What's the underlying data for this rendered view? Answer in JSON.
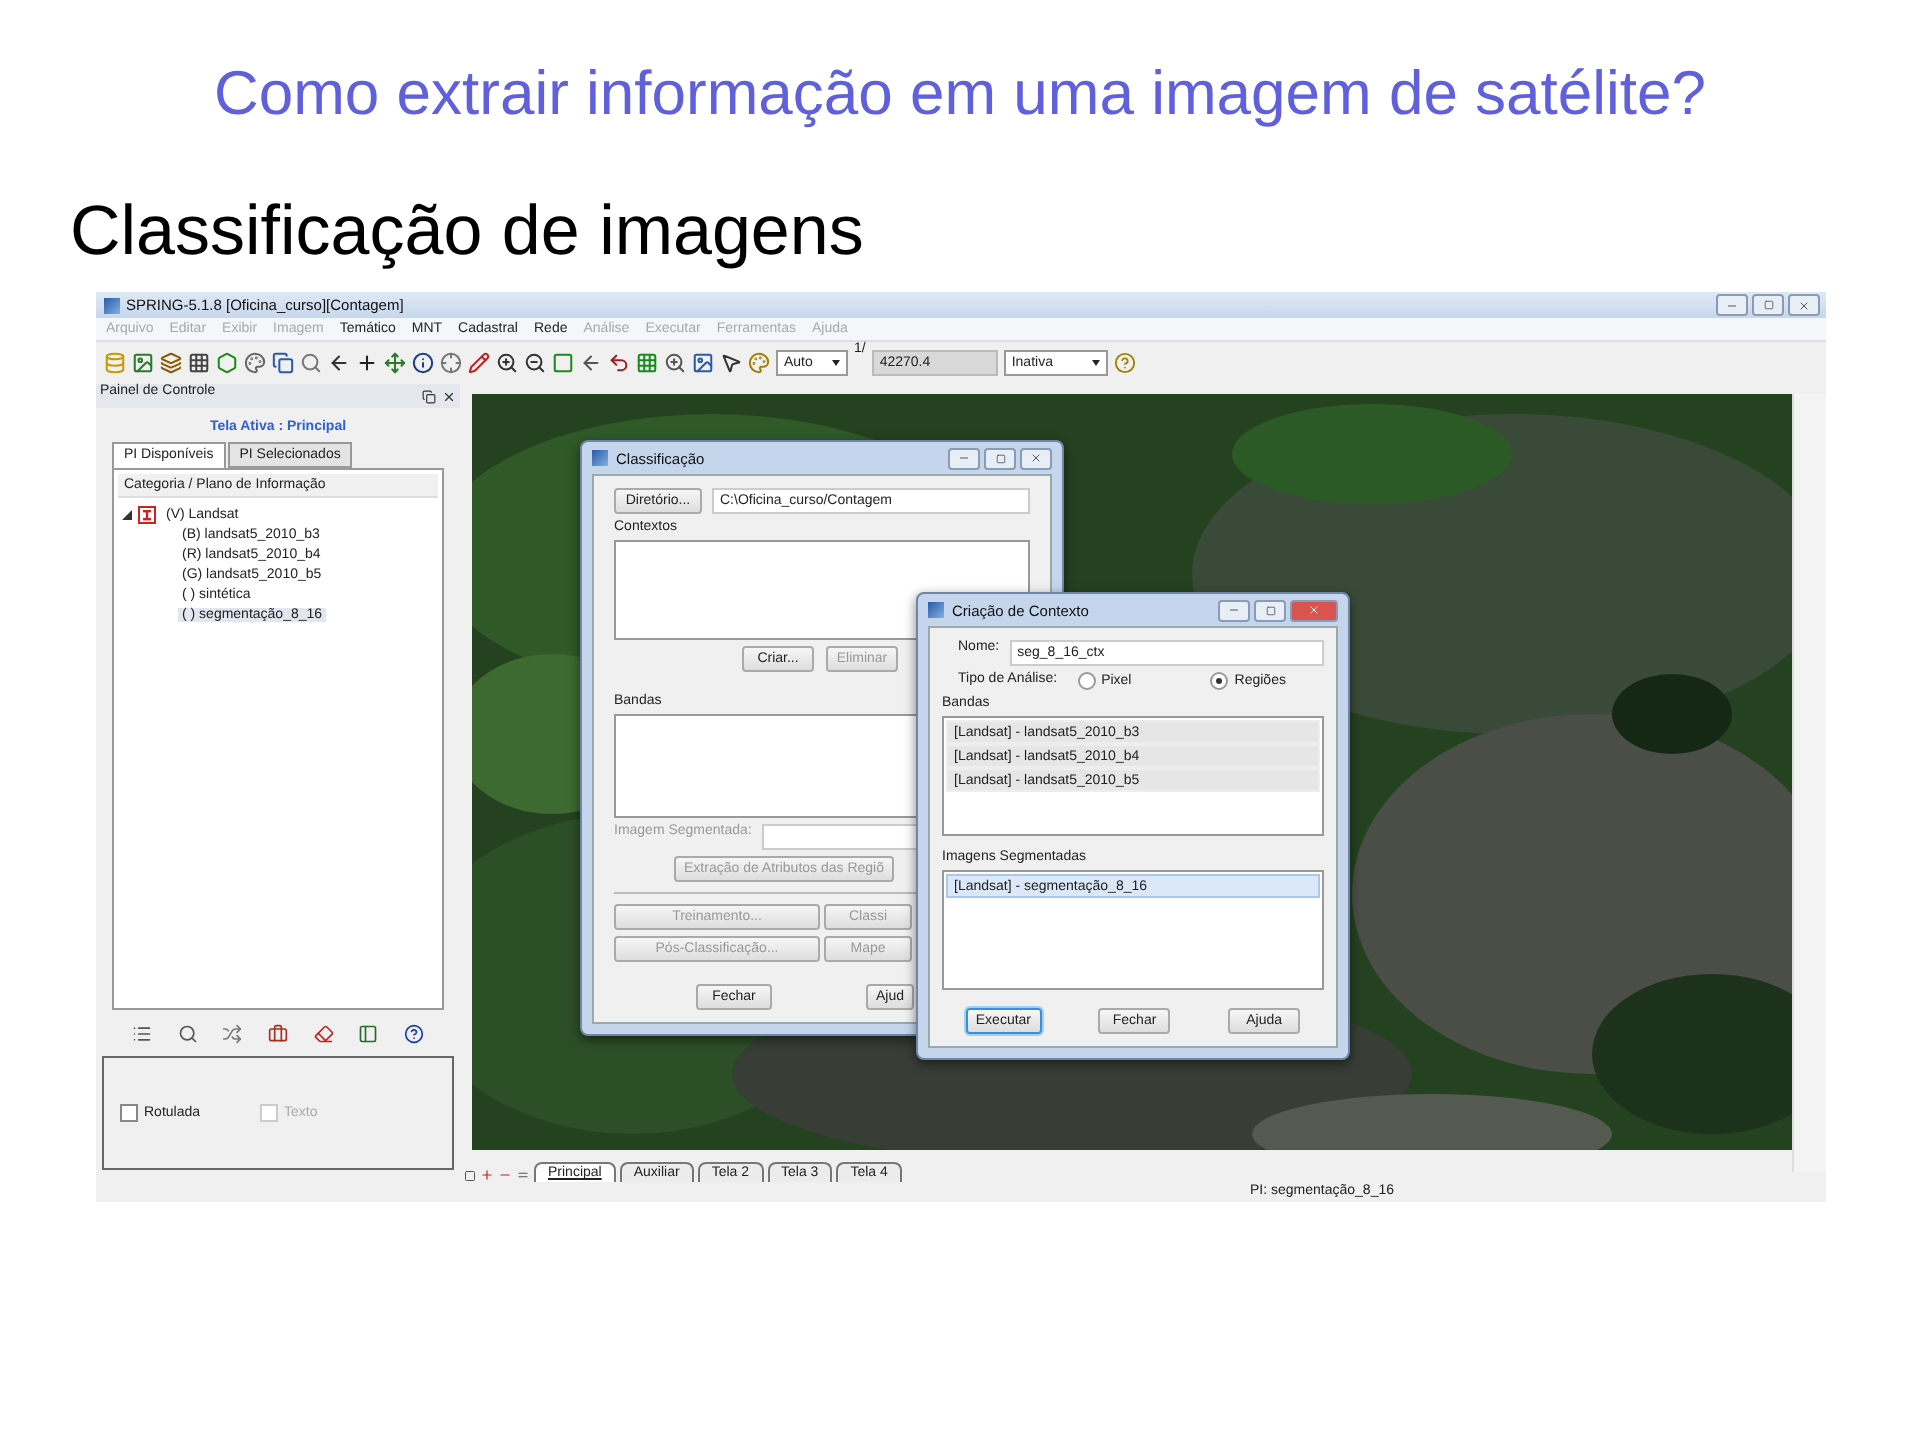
{
  "slide": {
    "title": "Como extrair informação em uma imagem de satélite?",
    "subtitle": "Classificação de imagens"
  },
  "window": {
    "title": "SPRING-5.1.8 [Oficina_curso][Contagem]",
    "menu": [
      {
        "label": "Arquivo",
        "disabled": true
      },
      {
        "label": "Editar",
        "disabled": true
      },
      {
        "label": "Exibir",
        "disabled": true
      },
      {
        "label": "Imagem",
        "disabled": true
      },
      {
        "label": "Temático",
        "disabled": false
      },
      {
        "label": "MNT",
        "disabled": false
      },
      {
        "label": "Cadastral",
        "disabled": false
      },
      {
        "label": "Rede",
        "disabled": false
      },
      {
        "label": "Análise",
        "disabled": true
      },
      {
        "label": "Executar",
        "disabled": true
      },
      {
        "label": "Ferramentas",
        "disabled": true
      },
      {
        "label": "Ajuda",
        "disabled": true
      }
    ],
    "toolbar": {
      "scale_mode": "Auto",
      "scale_prefix": "1/",
      "scale": "42270.4",
      "cursor_mode": "Inativa"
    }
  },
  "control_panel": {
    "title": "Painel de Controle",
    "active_screen": "Tela Ativa : Principal",
    "tabs": [
      {
        "label": "PI Disponíveis",
        "selected": true
      },
      {
        "label": "PI Selecionados",
        "selected": false
      }
    ],
    "tree_header": "Categoria / Plano de Informação",
    "tree": [
      {
        "label": "(V) Landsat",
        "expanded": true,
        "selected": false,
        "children": [
          {
            "label": "(B) landsat5_2010_b3",
            "selected": false
          },
          {
            "label": "(R) landsat5_2010_b4",
            "selected": false
          },
          {
            "label": "(G) landsat5_2010_b5",
            "selected": false
          },
          {
            "label": "( ) sintética",
            "selected": false
          },
          {
            "label": "( ) segmentação_8_16",
            "selected": true
          }
        ]
      }
    ],
    "options": [
      {
        "label": "Rotulada",
        "checked": false,
        "disabled": false
      },
      {
        "label": "Texto",
        "checked": false,
        "disabled": true
      }
    ]
  },
  "classification_dialog": {
    "title": "Classificação",
    "directory_button": {
      "label": "Diretório...",
      "disabled": false
    },
    "directory": "C:\\Oficina_curso/Contagem",
    "contexts_label": "Contextos",
    "context_buttons": [
      {
        "label": "Criar...",
        "disabled": false
      },
      {
        "label": "Eliminar",
        "disabled": true
      }
    ],
    "bands_label": "Bandas",
    "segmented_label": "Imagem Segmentada:",
    "segmented_disabled": true,
    "extract_button": {
      "label": "Extração de Atributos das Regiõ",
      "disabled": true
    },
    "action_rows": [
      [
        {
          "label": "Treinamento...",
          "disabled": true
        },
        {
          "label": "Classi",
          "disabled": true
        }
      ],
      [
        {
          "label": "Pós-Classificação...",
          "disabled": true
        },
        {
          "label": "Mape",
          "disabled": true
        }
      ]
    ],
    "footer_buttons": [
      {
        "label": "Fechar",
        "disabled": false
      },
      {
        "label": "Ajud",
        "disabled": false
      }
    ]
  },
  "context_dialog": {
    "title": "Criação de Contexto",
    "name_label": "Nome:",
    "name": "seg_8_16_ctx",
    "analysis_label": "Tipo de Análise:",
    "analysis_options": [
      {
        "label": "Pixel",
        "selected": false
      },
      {
        "label": "Regiões",
        "selected": true
      }
    ],
    "bands_label": "Bandas",
    "bands": [
      {
        "label": "[Landsat] - landsat5_2010_b3"
      },
      {
        "label": "[Landsat] - landsat5_2010_b4"
      },
      {
        "label": "[Landsat] - landsat5_2010_b5"
      }
    ],
    "segmented_label": "Imagens Segmentadas",
    "segmented": [
      {
        "label": "[Landsat] - segmentação_8_16",
        "selected": true
      }
    ],
    "buttons": [
      {
        "label": "Executar",
        "focused": true
      },
      {
        "label": "Fechar",
        "focused": false
      },
      {
        "label": "Ajuda",
        "focused": false
      }
    ]
  },
  "screen_tabs": [
    {
      "label": "Principal",
      "selected": true
    },
    {
      "label": "Auxiliar",
      "selected": false
    },
    {
      "label": "Tela 2",
      "selected": false
    },
    {
      "label": "Tela 3",
      "selected": false
    },
    {
      "label": "Tela 4",
      "selected": false
    }
  ],
  "status": "PI: segmentação_8_16"
}
